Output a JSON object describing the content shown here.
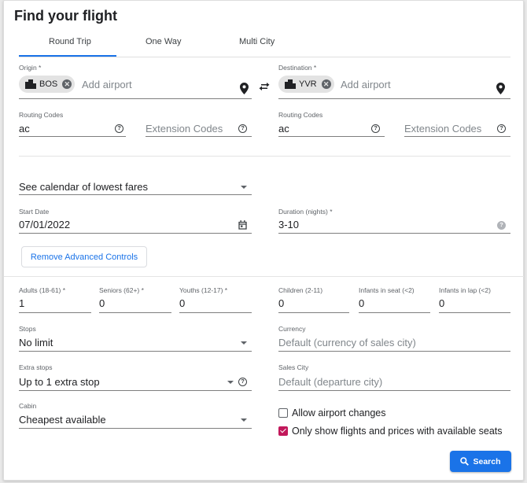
{
  "title": "Find your flight",
  "tabs": [
    {
      "label": "Round Trip",
      "active": true
    },
    {
      "label": "One Way",
      "active": false
    },
    {
      "label": "Multi City",
      "active": false
    }
  ],
  "origin": {
    "label": "Origin *",
    "chip": "BOS",
    "placeholder": "Add airport"
  },
  "destination": {
    "label": "Destination *",
    "chip": "YVR",
    "placeholder": "Add airport"
  },
  "origin_codes": {
    "routing_label": "Routing Codes",
    "routing_value": "ac",
    "extension_placeholder": "Extension Codes"
  },
  "destination_codes": {
    "routing_label": "Routing Codes",
    "routing_value": "ac",
    "extension_placeholder": "Extension Codes"
  },
  "calendar_select": "See calendar of lowest fares",
  "start_date": {
    "label": "Start Date",
    "value": "07/01/2022"
  },
  "duration": {
    "label": "Duration (nights) *",
    "value": "3-10"
  },
  "remove_advanced": "Remove Advanced Controls",
  "passengers": [
    {
      "label": "Adults (18-61) *",
      "value": "1"
    },
    {
      "label": "Seniors (62+) *",
      "value": "0"
    },
    {
      "label": "Youths (12-17) *",
      "value": "0"
    },
    {
      "label": "Children (2-11)",
      "value": "0"
    },
    {
      "label": "Infants in seat (<2)",
      "value": "0"
    },
    {
      "label": "Infants in lap (<2)",
      "value": "0"
    }
  ],
  "stops": {
    "label": "Stops",
    "value": "No limit"
  },
  "currency": {
    "label": "Currency",
    "placeholder": "Default (currency of sales city)"
  },
  "extra_stops": {
    "label": "Extra stops",
    "value": "Up to 1 extra stop"
  },
  "sales_city": {
    "label": "Sales City",
    "placeholder": "Default (departure city)"
  },
  "cabin": {
    "label": "Cabin",
    "value": "Cheapest available"
  },
  "checkboxes": [
    {
      "label": "Allow airport changes",
      "checked": false
    },
    {
      "label": "Only show flights and prices with available seats",
      "checked": true
    }
  ],
  "search_button": "Search",
  "colors": {
    "accent": "#1a73e8",
    "checkbox_checked": "#c2185b"
  },
  "icons": {
    "airport_chip": "city-icon",
    "location": "location-pin-icon",
    "swap": "swap-arrows-icon",
    "help": "help-circle-icon",
    "calendar": "calendar-icon",
    "dropdown": "caret-down-icon",
    "search": "search-icon"
  }
}
